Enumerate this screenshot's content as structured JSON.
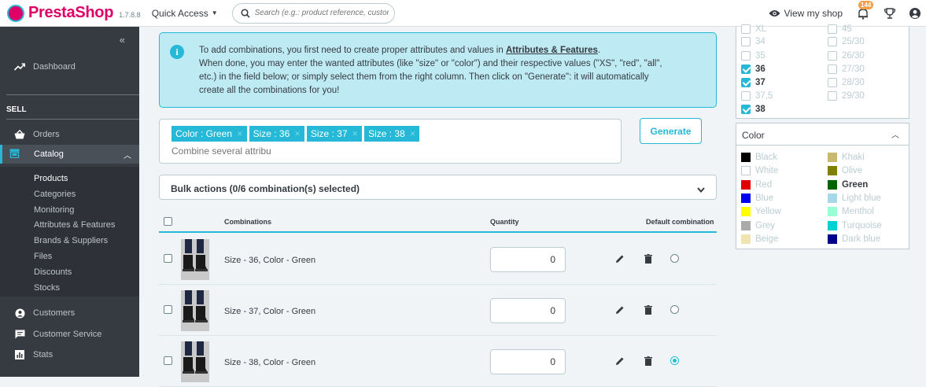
{
  "header": {
    "brand": "PrestaShop",
    "version": "1.7.8.8",
    "quick_access": "Quick Access",
    "search_placeholder": "Search (e.g.: product reference, custon",
    "view_shop": "View my shop",
    "notification_count": "144"
  },
  "sidebar": {
    "dashboard": "Dashboard",
    "sell": "SELL",
    "orders": "Orders",
    "catalog": "Catalog",
    "catalog_sub": [
      "Products",
      "Categories",
      "Monitoring",
      "Attributes & Features",
      "Brands & Suppliers",
      "Files",
      "Discounts",
      "Stocks"
    ],
    "customers": "Customers",
    "customer_service": "Customer Service",
    "stats": "Stats"
  },
  "info": {
    "line1_pre": "To add combinations, you first need to create proper attributes and values in ",
    "line1_link": "Attributes & Features",
    "line1_post": ".",
    "line2": "When done, you may enter the wanted attributes (like \"size\" or \"color\") and their respective values (\"XS\", \"red\", \"all\",",
    "line3": "etc.) in the field below; or simply select them from the right column. Then click on \"Generate\": it will automatically",
    "line4": "create all the combinations for you!"
  },
  "tags": [
    "Color : Green",
    "Size : 36",
    "Size : 37",
    "Size : 38"
  ],
  "tag_input_placeholder": "Combine several attribu",
  "generate_label": "Generate",
  "bulk_label": "Bulk actions (0/6 combination(s) selected)",
  "table": {
    "col_combinations": "Combinations",
    "col_quantity": "Quantity",
    "col_default": "Default combination",
    "rows": [
      {
        "name": "Size - 36, Color - Green",
        "quantity": "0",
        "default": false
      },
      {
        "name": "Size - 37, Color - Green",
        "quantity": "0",
        "default": false
      },
      {
        "name": "Size - 38, Color - Green",
        "quantity": "0",
        "default": true
      }
    ]
  },
  "size_panel": {
    "left": [
      {
        "label": "XL",
        "checked": false
      },
      {
        "label": "34",
        "checked": false
      },
      {
        "label": "35",
        "checked": false
      },
      {
        "label": "36",
        "checked": true
      },
      {
        "label": "37",
        "checked": true
      },
      {
        "label": "37,5",
        "checked": false
      },
      {
        "label": "38",
        "checked": true
      }
    ],
    "right": [
      {
        "label": "45",
        "checked": false
      },
      {
        "label": "25/30",
        "checked": false
      },
      {
        "label": "26/30",
        "checked": false
      },
      {
        "label": "27/30",
        "checked": false
      },
      {
        "label": "28/30",
        "checked": false
      },
      {
        "label": "29/30",
        "checked": false
      }
    ]
  },
  "color_panel": {
    "title": "Color",
    "left": [
      {
        "label": "Black",
        "color": "#000000",
        "selected": false
      },
      {
        "label": "White",
        "color": "#ffffff",
        "selected": false
      },
      {
        "label": "Red",
        "color": "#e00000",
        "selected": false
      },
      {
        "label": "Blue",
        "color": "#0000f0",
        "selected": false
      },
      {
        "label": "Yellow",
        "color": "#ffff00",
        "selected": false
      },
      {
        "label": "Grey",
        "color": "#aaaaaa",
        "selected": false
      },
      {
        "label": "Beige",
        "color": "#f0e4b0",
        "selected": false
      }
    ],
    "right": [
      {
        "label": "Khaki",
        "color": "#c8b870",
        "selected": false
      },
      {
        "label": "Olive",
        "color": "#808000",
        "selected": false
      },
      {
        "label": "Green",
        "color": "#006400",
        "selected": true
      },
      {
        "label": "Light blue",
        "color": "#a6d8e8",
        "selected": false
      },
      {
        "label": "Menthol",
        "color": "#98ffd4",
        "selected": false
      },
      {
        "label": "Turquoise",
        "color": "#00d2d2",
        "selected": false
      },
      {
        "label": "Dark blue",
        "color": "#00008b",
        "selected": false
      }
    ]
  },
  "colors": {
    "accent": "#25b9d7",
    "brand": "#df0067",
    "sidebar_bg": "#363a41"
  }
}
